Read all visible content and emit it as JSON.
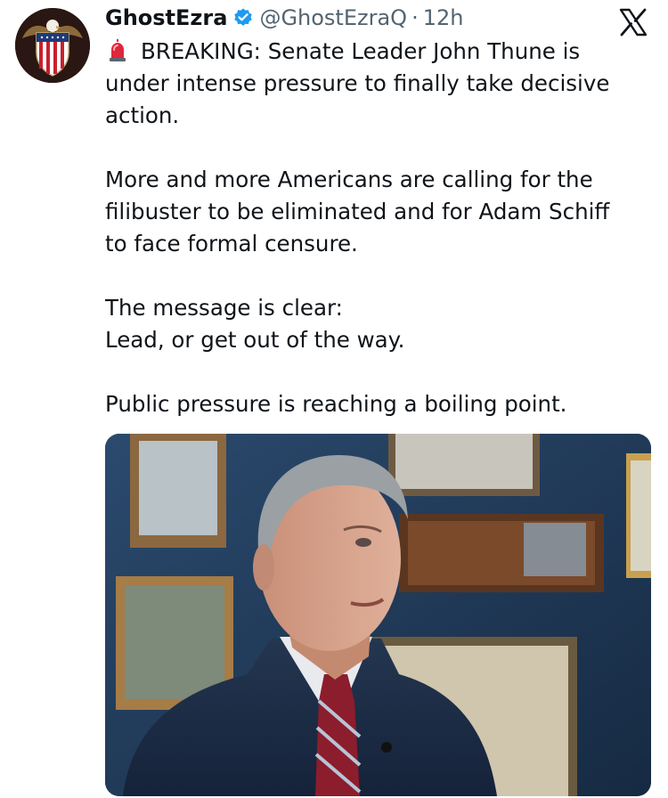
{
  "tweet": {
    "author": {
      "display_name": "GhostEzra",
      "handle": "@GhostEzraQ",
      "verified": true,
      "avatar_icon": "eagle-shield-icon"
    },
    "separator": "·",
    "timestamp": "12h",
    "platform_icon": "x-logo-icon",
    "lines": {
      "p1_line1": "BREAKING: Senate Leader John Thune is",
      "p1_line2": "under intense pressure to finally take decisive",
      "p1_line3": "action.",
      "p2_line1": "More and more Americans are calling for the",
      "p2_line2": "filibuster to be eliminated and for Adam Schiff",
      "p2_line3": "to face formal censure.",
      "p3_line1": "The message is clear:",
      "p3_line2": "Lead, or get out of the way.",
      "p4_line1": "Public pressure is reaching a boiling point."
    },
    "leading_emoji": "siren-icon",
    "media": {
      "kind": "photo",
      "subject": "man-in-suit-photo"
    }
  },
  "colors": {
    "verified_blue": "#1d9bf0",
    "secondary_text": "#536471",
    "primary_text": "#0f1419",
    "photo_wall": "#1e3550"
  }
}
